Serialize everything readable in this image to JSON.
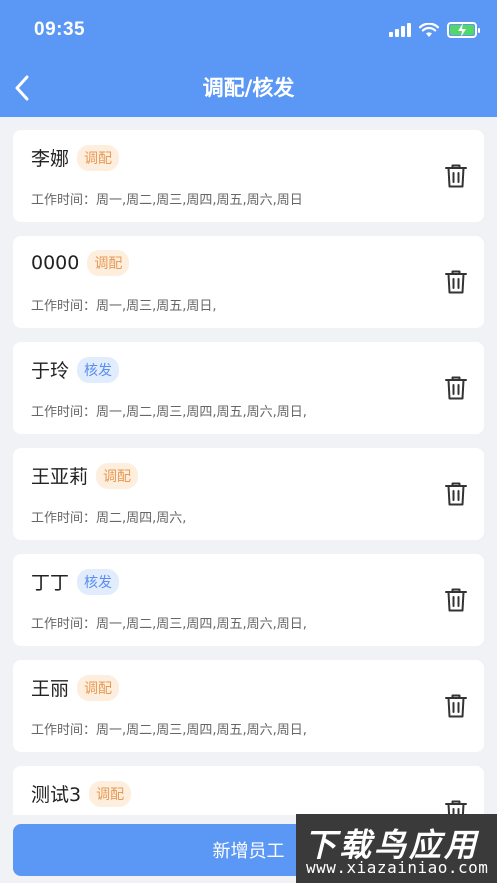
{
  "status_bar": {
    "time": "09:35"
  },
  "nav": {
    "title": "调配/核发"
  },
  "employees": [
    {
      "name": "李娜",
      "tag": "调配",
      "tag_color": "orange",
      "work_label": "工作时间：",
      "days": "周一,周二,周三,周四,周五,周六,周日"
    },
    {
      "name": "0000",
      "tag": "调配",
      "tag_color": "orange",
      "work_label": "工作时间：",
      "days": "周一,周三,周五,周日,"
    },
    {
      "name": "于玲",
      "tag": "核发",
      "tag_color": "blue",
      "work_label": "工作时间：",
      "days": "周一,周二,周三,周四,周五,周六,周日,"
    },
    {
      "name": "王亚莉",
      "tag": "调配",
      "tag_color": "orange",
      "work_label": "工作时间：",
      "days": "周二,周四,周六,"
    },
    {
      "name": "丁丁",
      "tag": "核发",
      "tag_color": "blue",
      "work_label": "工作时间：",
      "days": "周一,周二,周三,周四,周五,周六,周日,"
    },
    {
      "name": "王丽",
      "tag": "调配",
      "tag_color": "orange",
      "work_label": "工作时间：",
      "days": "周一,周二,周三,周四,周五,周六,周日,"
    },
    {
      "name": "测试3",
      "tag": "调配",
      "tag_color": "orange",
      "work_label": "",
      "days": ""
    }
  ],
  "add_button": {
    "label": "新增员工"
  },
  "watermark": {
    "main": "下载鸟应用",
    "sub": "www.xiazainiao.com"
  },
  "colors": {
    "primary": "#5b97f4",
    "tag_orange_text": "#e89a55",
    "tag_blue_text": "#5b8ef0"
  }
}
